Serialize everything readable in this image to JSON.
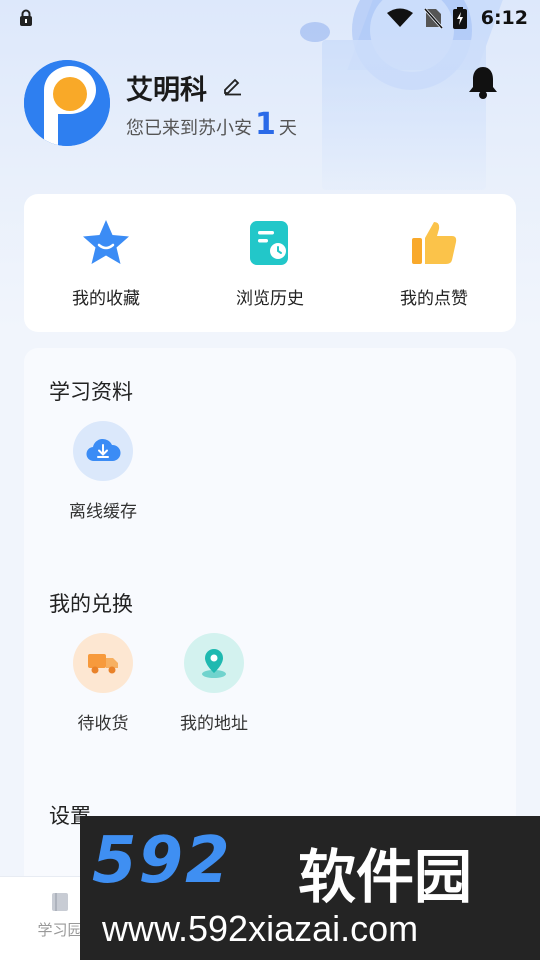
{
  "status_bar": {
    "time": "6:12"
  },
  "profile": {
    "name": "艾明科",
    "days_prefix": "您已来到苏小安",
    "days_count": "1",
    "days_suffix": "天"
  },
  "quick_actions": [
    {
      "label": "我的收藏",
      "icon": "star-icon"
    },
    {
      "label": "浏览历史",
      "icon": "history-icon"
    },
    {
      "label": "我的点赞",
      "icon": "thumbs-up-icon"
    }
  ],
  "sections": {
    "study": {
      "title": "学习资料",
      "items": [
        {
          "label": "离线缓存",
          "icon": "cloud-download-icon"
        }
      ]
    },
    "exchange": {
      "title": "我的兑换",
      "items": [
        {
          "label": "待收货",
          "icon": "truck-icon"
        },
        {
          "label": "我的地址",
          "icon": "location-icon"
        }
      ]
    },
    "settings": {
      "title": "设置"
    }
  },
  "bottom_nav": {
    "first_label": "学习园"
  },
  "watermark": {
    "brand": "592",
    "brand_cn": "软件园",
    "url": "www.592xiazai.com"
  },
  "colors": {
    "accent": "#2a6ae8",
    "star": "#3b8cf5",
    "history": "#22c7c9",
    "thumb": "#f9a92b",
    "truck": "#f79a3c",
    "location": "#1fb9b0"
  }
}
